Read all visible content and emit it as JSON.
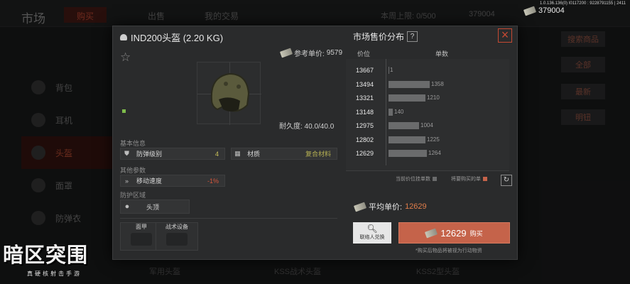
{
  "background": {
    "title": "市场",
    "tabs": [
      {
        "label": "购买",
        "active": true
      },
      {
        "label": "出售",
        "active": false
      },
      {
        "label": "我的交易",
        "active": false
      }
    ],
    "listing_limit": "本周上限: 0/500",
    "currency_amount": "379004",
    "sidebar": [
      {
        "label": "背包",
        "active": false
      },
      {
        "label": "耳机",
        "active": false
      },
      {
        "label": "头盔",
        "active": true
      },
      {
        "label": "面罩",
        "active": false
      },
      {
        "label": "防弹衣",
        "active": false
      }
    ],
    "right_buttons": [
      "搜索商品",
      "全部",
      "最新",
      "明钮"
    ],
    "bottom_labels": [
      "军用头盔",
      "KSS战术头盔",
      "KSS2型头盔"
    ]
  },
  "top_overlay": {
    "debug_text": "1.0.136.136(0) I0117200 : 9228791155 | 2411",
    "money": "379004"
  },
  "item": {
    "name": "IND200头盔 (2.20 KG)",
    "reference_price_label": "参考单价:",
    "reference_price": "9579",
    "durability": "耐久度: 40.0/40.0",
    "section_basic": "基本信息",
    "section_other": "其他参数",
    "section_protect": "防护区域",
    "attributes": [
      {
        "label": "防弹级别",
        "value": "4",
        "icon": "shield-icon"
      },
      {
        "label": "材质",
        "value": "复合材料",
        "icon": "material-icon"
      },
      {
        "label": "移动速度",
        "value": "-1%",
        "icon": "speed-icon"
      }
    ],
    "protect_region": "头顶",
    "slots": [
      {
        "label": "面甲"
      },
      {
        "label": "战术设备"
      }
    ]
  },
  "market": {
    "title": "市场售价分布",
    "help": "?",
    "close": "×",
    "col_price": "价位",
    "col_qty": "单数",
    "rows": [
      {
        "price": "13667",
        "qty": "1"
      },
      {
        "price": "13494",
        "qty": "1358"
      },
      {
        "price": "13321",
        "qty": "1210"
      },
      {
        "price": "13148",
        "qty": "140"
      },
      {
        "price": "12975",
        "qty": "1004"
      },
      {
        "price": "12802",
        "qty": "1225"
      },
      {
        "price": "12629",
        "qty": "1264"
      }
    ],
    "legend_current": "当前价位挂单数",
    "legend_buy": "将要购买的单",
    "refresh_icon": "refresh-icon",
    "avg_label": "平均单价:",
    "avg_value": "12629",
    "contact_label": "联络人兑换",
    "buy_price": "12629",
    "buy_label": "购买",
    "buy_note": "*购买后物品将被视为行动物资",
    "colors": {
      "accent": "#c5634a",
      "close": "#c54932",
      "avg": "#e07d4a"
    }
  },
  "logo": {
    "title": "暗区突围",
    "subtitle": "真硬核射击手游"
  },
  "chart_data": {
    "type": "bar",
    "title": "市场售价分布",
    "xlabel": "价位",
    "ylabel": "单数",
    "categories": [
      "13667",
      "13494",
      "13321",
      "13148",
      "12975",
      "12802",
      "12629"
    ],
    "values": [
      1,
      1358,
      1210,
      140,
      1004,
      1225,
      1264
    ]
  }
}
